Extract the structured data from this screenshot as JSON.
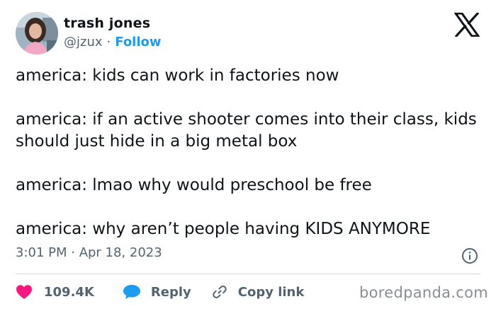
{
  "author": {
    "display_name": "trash jones",
    "handle": "@jzux",
    "separator": "·",
    "follow_label": "Follow"
  },
  "tweet": {
    "lines": [
      "america: kids can work in factories now",
      "america: if an active shooter comes into their class, kids should just hide in a big metal box",
      "america: lmao why would preschool be free",
      "america: why aren’t people having KIDS ANYMORE"
    ],
    "timestamp": "3:01 PM · Apr 18, 2023"
  },
  "actions": {
    "like_count": "109.4K",
    "reply_label": "Reply",
    "copy_link_label": "Copy link"
  },
  "icons": {
    "brand": "x-logo-icon",
    "info": "info-icon",
    "like": "heart-icon",
    "reply": "speech-bubble-icon",
    "copy": "link-icon"
  },
  "colors": {
    "text": "#0f1419",
    "secondary": "#536471",
    "accent": "#1d9bf0",
    "like": "#f91880",
    "divider": "#cfd9de"
  },
  "watermark": "boredpanda.com"
}
